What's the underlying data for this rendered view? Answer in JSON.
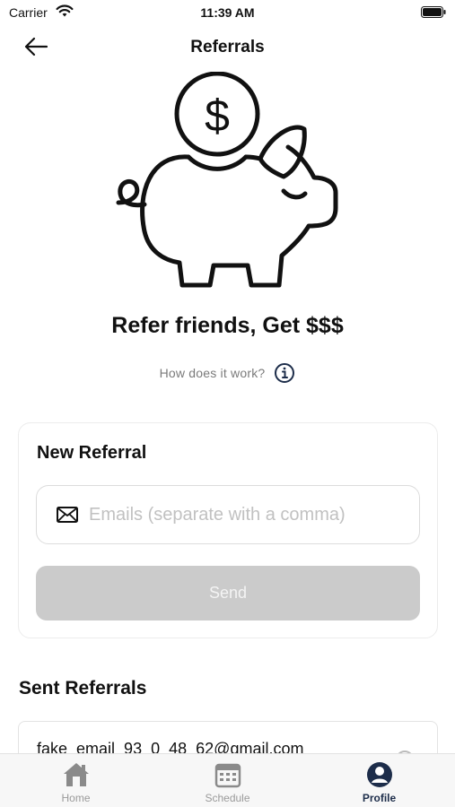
{
  "status_bar": {
    "carrier": "Carrier",
    "time": "11:39 AM"
  },
  "nav": {
    "title": "Referrals",
    "back_icon": "arrow-left-icon"
  },
  "hero": {
    "illustration": "piggy-bank-dollar-icon",
    "headline": "Refer friends, Get $$$"
  },
  "how_it_works": {
    "text": "How does it work?",
    "icon": "info-circle-icon"
  },
  "new_referral": {
    "title": "New Referral",
    "email_field": {
      "value": "",
      "placeholder": "Emails (separate with a comma)",
      "icon": "mail-icon"
    },
    "send_label": "Send"
  },
  "sent_referrals": {
    "title": "Sent Referrals",
    "items": [
      {
        "email": "fake_email_93_0_48_62@gmail.com"
      }
    ]
  },
  "tabs": [
    {
      "label": "Home",
      "icon": "home-icon",
      "active": false
    },
    {
      "label": "Schedule",
      "icon": "calendar-icon",
      "active": false
    },
    {
      "label": "Profile",
      "icon": "profile-icon",
      "active": true
    }
  ],
  "colors": {
    "primary": "#1d2d4a",
    "disabled_button": "#cbcbcb",
    "placeholder": "#c1c1c1",
    "tab_inactive": "#9a9a9a"
  }
}
